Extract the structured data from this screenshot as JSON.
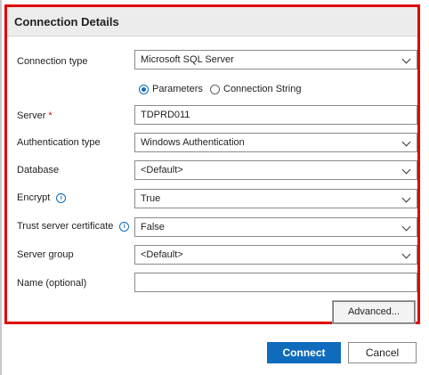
{
  "section": {
    "title": "Connection Details"
  },
  "fields": {
    "connection_type": {
      "label": "Connection type",
      "value": "Microsoft SQL Server"
    },
    "input_mode": {
      "options": [
        "Parameters",
        "Connection String"
      ],
      "selected": "Parameters"
    },
    "server": {
      "label": "Server",
      "required_marker": "*",
      "value": "TDPRD011"
    },
    "auth_type": {
      "label": "Authentication type",
      "value": "Windows Authentication"
    },
    "database": {
      "label": "Database",
      "value": "<Default>"
    },
    "encrypt": {
      "label": "Encrypt",
      "value": "True"
    },
    "trust_cert": {
      "label": "Trust server certificate",
      "value": "False"
    },
    "server_group": {
      "label": "Server group",
      "value": "<Default>"
    },
    "name": {
      "label": "Name (optional)",
      "value": ""
    }
  },
  "buttons": {
    "advanced": "Advanced...",
    "connect": "Connect",
    "cancel": "Cancel"
  },
  "colors": {
    "highlight_border": "#e00000",
    "primary": "#0f6cbd"
  }
}
